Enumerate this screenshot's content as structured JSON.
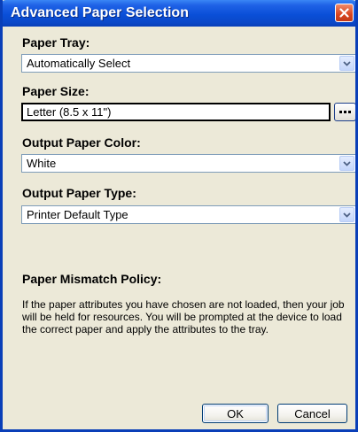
{
  "window": {
    "title": "Advanced Paper Selection"
  },
  "paper_tray": {
    "label": "Paper Tray:",
    "value": "Automatically Select"
  },
  "paper_size": {
    "label": "Paper Size:",
    "value": "Letter (8.5 x 11\")"
  },
  "output_color": {
    "label": "Output Paper Color:",
    "value": "White"
  },
  "output_type": {
    "label": "Output Paper Type:",
    "value": "Printer Default Type"
  },
  "mismatch_policy": {
    "label": "Paper Mismatch Policy:",
    "text": "If the paper attributes you have chosen are not loaded, then your job will be held for resources.  You will be prompted at the device to load the correct paper and apply the attributes to the tray."
  },
  "buttons": {
    "ok": "OK",
    "cancel": "Cancel"
  },
  "icons": {
    "close": "close-icon",
    "dropdown": "chevron-down-icon",
    "browse": "ellipsis-icon"
  },
  "colors": {
    "titlebar": "#0a4fd8",
    "window_bg": "#ece9d8",
    "close_button": "#d8451f"
  }
}
